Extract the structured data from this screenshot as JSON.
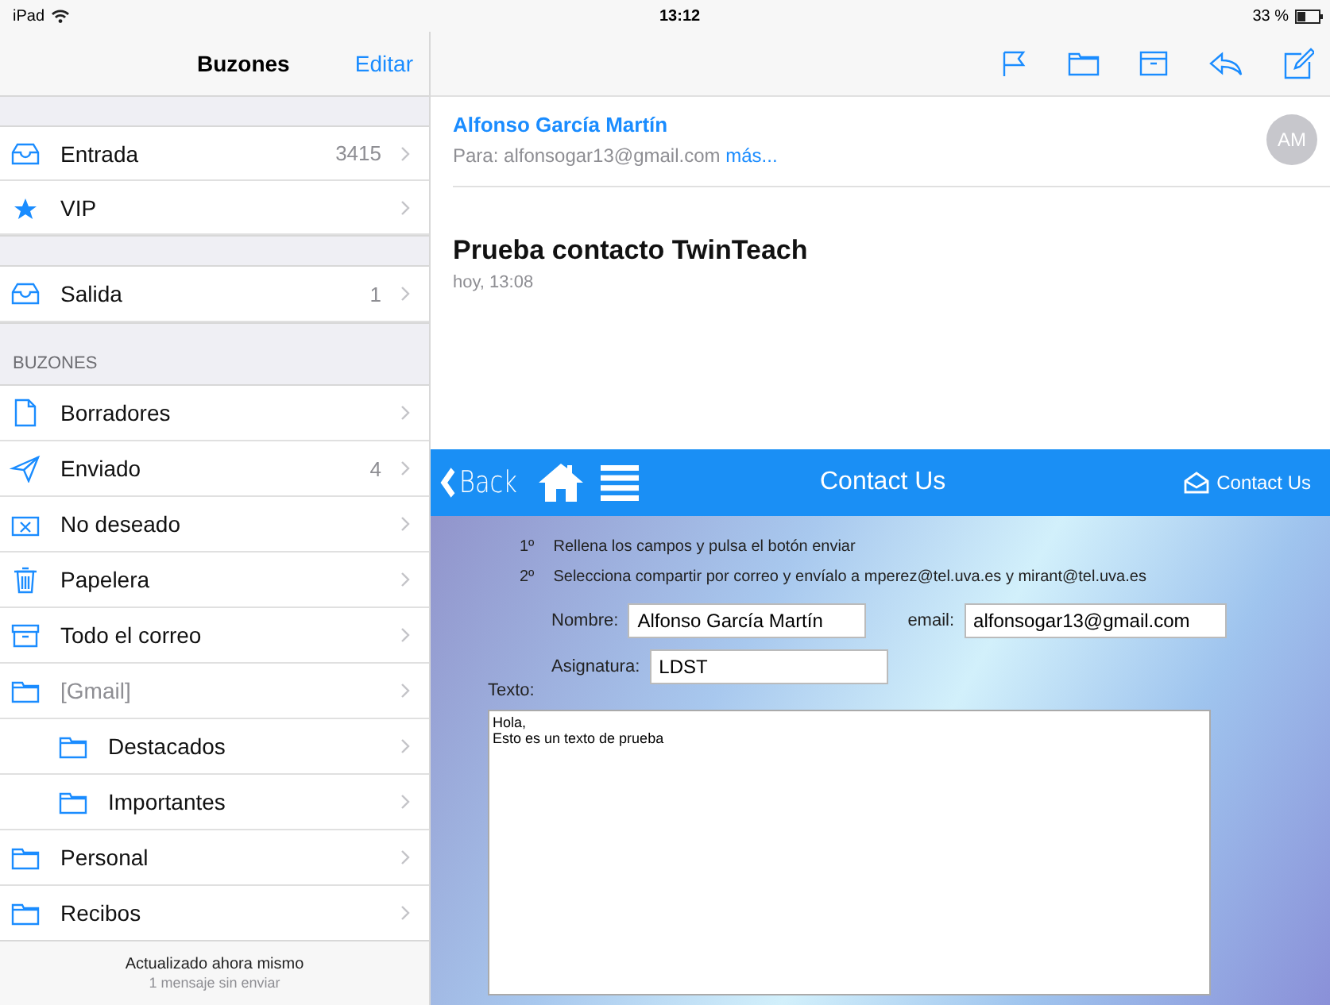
{
  "status_bar": {
    "device": "iPad",
    "time": "13:12",
    "battery": "33 %"
  },
  "sidebar": {
    "title": "Buzones",
    "edit": "Editar",
    "groups": [
      {
        "items": [
          {
            "kind": "inbox",
            "label": "Entrada",
            "count": "3415",
            "disabled": false
          },
          {
            "kind": "star",
            "label": "VIP",
            "disabled": false
          }
        ]
      },
      {
        "items": [
          {
            "kind": "inbox",
            "label": "Salida",
            "count": "1",
            "disabled": false
          }
        ]
      },
      {
        "heading": "BUZONES",
        "items": [
          {
            "kind": "doc",
            "label": "Borradores",
            "disabled": false
          },
          {
            "kind": "send",
            "label": "Enviado",
            "count": "4",
            "disabled": false
          },
          {
            "kind": "junk",
            "label": "No deseado",
            "disabled": false
          },
          {
            "kind": "trash",
            "label": "Papelera",
            "disabled": false
          },
          {
            "kind": "archive",
            "label": "Todo el correo",
            "disabled": false
          },
          {
            "kind": "folder",
            "label": "[Gmail]",
            "disabled": true,
            "children": [
              {
                "kind": "folder",
                "label": "Destacados",
                "disabled": false
              },
              {
                "kind": "folder",
                "label": "Importantes",
                "disabled": false
              }
            ]
          },
          {
            "kind": "folder",
            "label": "Personal",
            "disabled": false
          },
          {
            "kind": "folder",
            "label": "Recibos",
            "disabled": false
          }
        ]
      }
    ],
    "footer": {
      "status": "Actualizado ahora mismo",
      "detail": "1 mensaje sin enviar"
    }
  },
  "message": {
    "sender": "Alfonso García Martín",
    "to": "Para: alfonsogar13@gmail.com",
    "more": "más...",
    "avatar": "AM",
    "subject": "Prueba contacto TwinTeach",
    "date": "hoy, 13:08"
  },
  "webview": {
    "back": "Back",
    "title": "Contact Us",
    "contact_link": "Contact Us",
    "steps": [
      {
        "num": "1º",
        "text": "Rellena los campos y pulsa el botón enviar"
      },
      {
        "num": "2º",
        "text": "Selecciona compartir por correo y envíalo a mperez@tel.uva.es y mirant@tel.uva.es"
      }
    ],
    "fields": [
      {
        "label": "Nombre:",
        "value": "Alfonso García Martín"
      },
      {
        "label": "email:",
        "value": "alfonsogar13@gmail.com"
      },
      {
        "label": "Asignatura:",
        "value": "LDST"
      }
    ],
    "text_label": "Texto:",
    "text_value": "Hola,\nEsto es un texto de prueba"
  }
}
